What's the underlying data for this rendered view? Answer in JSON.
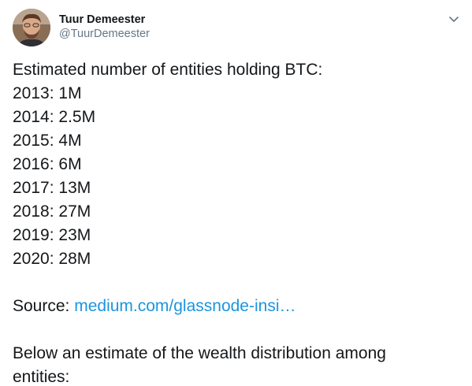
{
  "author": {
    "name": "Tuur Demeester",
    "handle": "@TuurDemeester"
  },
  "icons": {
    "avatar": "profile-photo",
    "menu": "chevron-down-icon"
  },
  "colors": {
    "link": "#1b95e0",
    "handle": "#657786",
    "text": "#14171a"
  },
  "tweet": {
    "intro": "Estimated number of entities holding BTC:",
    "stats": [
      "2013: 1M",
      "2014: 2.5M",
      "2015: 4M",
      "2016: 6M",
      "2017: 13M",
      "2018: 27M",
      "2019: 23M",
      "2020: 28M"
    ],
    "source_label": "Source: ",
    "source_link": "medium.com/glassnode-insi…",
    "outro_line1": "Below an estimate of the wealth distribution among",
    "outro_line2": "entities:"
  }
}
